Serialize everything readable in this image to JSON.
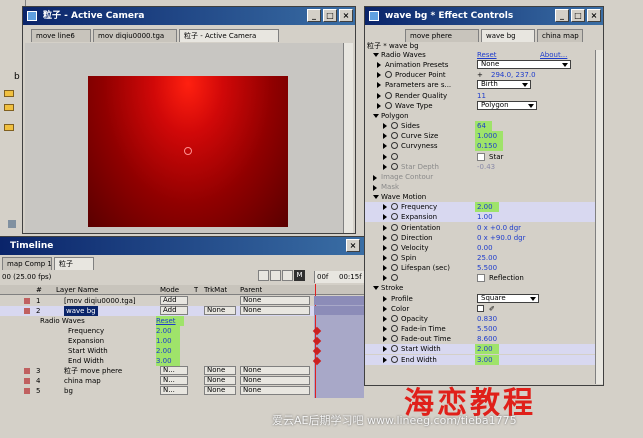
{
  "comp_window": {
    "title": "粒子 - Active Camera",
    "tabs": [
      "move line6",
      "mov diqiu0000.tga",
      "粒子 - Active Camera"
    ]
  },
  "left_sliver": {
    "letter": "b"
  },
  "effect_controls": {
    "title": "wave bg * Effect Controls",
    "tabs": [
      "move phere",
      "wave bg",
      "china map"
    ],
    "breadcrumb": "粒子 * wave bg",
    "reset_label": "Reset",
    "about_label": "About...",
    "rows": [
      {
        "label": "Radio Waves",
        "value": "Reset"
      },
      {
        "label": "Animation Presets",
        "value": "None"
      },
      {
        "label": "Producer Point",
        "value": "294.0, 237.0"
      },
      {
        "label": "Parameters are s...",
        "value": "Birth"
      },
      {
        "label": "Render Quality",
        "value": "11"
      },
      {
        "label": "Wave Type",
        "value": "Polygon"
      },
      {
        "label": "Polygon",
        "value": ""
      },
      {
        "label": "Sides",
        "value": "64"
      },
      {
        "label": "Curve Size",
        "value": "1.000"
      },
      {
        "label": "Curvyness",
        "value": "0.150"
      },
      {
        "label": "",
        "value": "Star"
      },
      {
        "label": "Star Depth",
        "value": "-0.43"
      },
      {
        "label": "Image Contour",
        "value": ""
      },
      {
        "label": "Mask",
        "value": ""
      },
      {
        "label": "Wave Motion",
        "value": ""
      },
      {
        "label": "Frequency",
        "value": "2.00"
      },
      {
        "label": "Expansion",
        "value": "1.00"
      },
      {
        "label": "Orientation",
        "value": "0 x +0.0 dgr"
      },
      {
        "label": "Direction",
        "value": "0 x +90.0 dgr"
      },
      {
        "label": "Velocity",
        "value": "0.00"
      },
      {
        "label": "Spin",
        "value": "25.00"
      },
      {
        "label": "Lifespan (sec)",
        "value": "5.500"
      },
      {
        "label": "",
        "value": "Reflection"
      },
      {
        "label": "Stroke",
        "value": ""
      },
      {
        "label": "Profile",
        "value": "Square"
      },
      {
        "label": "Color",
        "value": ""
      },
      {
        "label": "Opacity",
        "value": "0.830"
      },
      {
        "label": "Fade-in Time",
        "value": "5.500"
      },
      {
        "label": "Fade-out Time",
        "value": "8.600"
      },
      {
        "label": "Start Width",
        "value": "2.00"
      },
      {
        "label": "End Width",
        "value": "3.00"
      }
    ]
  },
  "timeline": {
    "title": "Timeline",
    "tabs": [
      "map Comp 1",
      "粒子"
    ],
    "time": "00 (25.00 fps)",
    "time_prefix": "00",
    "ruler": [
      "00f",
      "00:15f"
    ],
    "headers": [
      "#",
      "Layer Name",
      "Mode",
      "T",
      "TrkMat",
      "Parent"
    ],
    "layers": [
      {
        "num": "1",
        "name": "[mov diqiu0000.tga]",
        "mode": "Add",
        "trkmat": "",
        "parent": "None",
        "color": "#c06060"
      },
      {
        "num": "2",
        "name": "wave bg",
        "mode": "Add",
        "trkmat": "None",
        "parent": "None",
        "color": "#c06060"
      },
      {
        "num": "",
        "name": "Radio Waves",
        "mode": "Reset",
        "trkmat": "",
        "parent": "",
        "color": ""
      },
      {
        "num": "",
        "name": "Frequency",
        "mode": "2.00",
        "trkmat": "",
        "parent": "",
        "color": ""
      },
      {
        "num": "",
        "name": "Expansion",
        "mode": "1.00",
        "trkmat": "",
        "parent": "",
        "color": ""
      },
      {
        "num": "",
        "name": "Start Width",
        "mode": "2.00",
        "trkmat": "",
        "parent": "",
        "color": ""
      },
      {
        "num": "",
        "name": "End Width",
        "mode": "3.00",
        "trkmat": "",
        "parent": "",
        "color": ""
      },
      {
        "num": "3",
        "name": "粒子 move phere",
        "mode": "N...",
        "trkmat": "None",
        "parent": "None",
        "color": "#c06060"
      },
      {
        "num": "4",
        "name": "china map",
        "mode": "N...",
        "trkmat": "None",
        "parent": "None",
        "color": "#c06060"
      },
      {
        "num": "5",
        "name": "bg",
        "mode": "N...",
        "trkmat": "None",
        "parent": "None",
        "color": "#c06060"
      }
    ]
  },
  "watermark": {
    "big": "海恋教程",
    "small": "爱云AE后期学习吧 www.lineeg.com/tieba1775"
  },
  "colors": {
    "title_blue": "#0a246a",
    "highlight_green": "#9fe36a",
    "value_blue": "#1e3ccc",
    "watermark_red": "#e0201a"
  }
}
